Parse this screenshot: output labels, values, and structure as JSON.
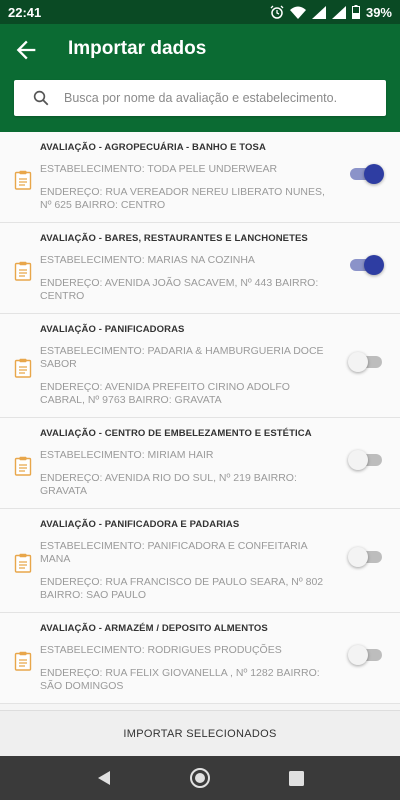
{
  "status_bar": {
    "time": "22:41",
    "battery": "39%"
  },
  "header": {
    "title": "Importar dados",
    "search_placeholder": "Busca por nome da avaliação e estabelecimento."
  },
  "items": [
    {
      "evaluation": "AVALIAÇÃO - AGROPECUÁRIA - BANHO E TOSA",
      "establishment": "ESTABELECIMENTO: TODA PELE UNDERWEAR",
      "address": "ENDEREÇO: RUA VEREADOR NEREU LIBERATO NUNES, Nº 625 BAIRRO: CENTRO",
      "selected": true
    },
    {
      "evaluation": "AVALIAÇÃO - BARES, RESTAURANTES E LANCHONETES",
      "establishment": "ESTABELECIMENTO: MARIAS NA COZINHA",
      "address": "ENDEREÇO: AVENIDA JOÃO SACAVEM, Nº 443 BAIRRO: CENTRO",
      "selected": true
    },
    {
      "evaluation": "AVALIAÇÃO - PANIFICADORAS",
      "establishment": "ESTABELECIMENTO: PADARIA & HAMBURGUERIA DOCE SABOR",
      "address": "ENDEREÇO: AVENIDA PREFEITO CIRINO ADOLFO CABRAL, Nº 9763 BAIRRO: GRAVATA",
      "selected": false
    },
    {
      "evaluation": "AVALIAÇÃO - CENTRO DE EMBELEZAMENTO E ESTÉTICA",
      "establishment": "ESTABELECIMENTO: MIRIAM HAIR",
      "address": "ENDEREÇO: AVENIDA RIO DO SUL, Nº 219 BAIRRO: GRAVATA",
      "selected": false
    },
    {
      "evaluation": "AVALIAÇÃO - PANIFICADORA E PADARIAS",
      "establishment": "ESTABELECIMENTO: PANIFICADORA E CONFEITARIA MANA",
      "address": "ENDEREÇO: RUA FRANCISCO DE PAULO SEARA, Nº 802 BAIRRO: SAO PAULO",
      "selected": false
    },
    {
      "evaluation": "AVALIAÇÃO - ARMAZÉM / DEPOSITO ALMENTOS",
      "establishment": "ESTABELECIMENTO: RODRIGUES PRODUÇÕES",
      "address": "ENDEREÇO: RUA FELIX GIOVANELLA , Nº 1282 BAIRRO: SÃO DOMINGOS",
      "selected": false
    }
  ],
  "footer": {
    "import_label": "IMPORTAR SELECIONADOS"
  },
  "colors": {
    "app_bar": "#0b6b33",
    "status_bar": "#0a4a24",
    "toggle_on": "#2e3da2"
  }
}
